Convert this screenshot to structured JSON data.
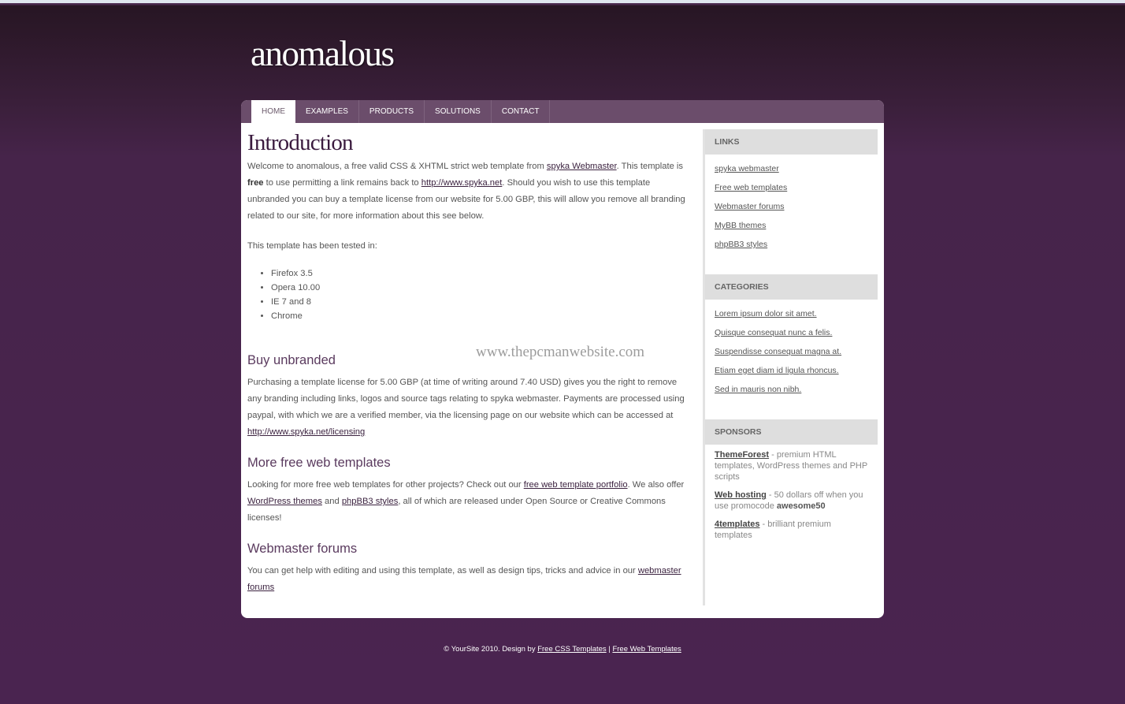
{
  "site": {
    "logo": "anomalous"
  },
  "nav": {
    "tabs": [
      {
        "label": "HOME",
        "active": true
      },
      {
        "label": "EXAMPLES",
        "active": false
      },
      {
        "label": "PRODUCTS",
        "active": false
      },
      {
        "label": "SOLUTIONS",
        "active": false
      },
      {
        "label": "CONTACT",
        "active": false
      }
    ]
  },
  "content": {
    "intro": {
      "title": "Introduction",
      "p1_a": "Welcome to anomalous, a free valid CSS & XHTML strict web template from ",
      "p1_link1": "spyka Webmaster",
      "p1_b": ". This template is ",
      "p1_bold": "free",
      "p1_c": " to use permitting a link remains back to ",
      "p1_link2": "http://www.spyka.net",
      "p1_d": ". Should you wish to use this template unbranded you can buy a template license from our website for 5.00 GBP, this will allow you remove all branding related to our site, for more information about this see below.",
      "p2": "This template has been tested in:",
      "browsers": [
        "Firefox 3.5",
        "Opera 10.00",
        "IE 7 and 8",
        "Chrome"
      ]
    },
    "buy": {
      "title": "Buy unbranded",
      "text": "Purchasing a template license for 5.00 GBP (at time of writing around 7.40 USD) gives you the right to remove any branding including links, logos and source tags relating to spyka webmaster. Payments are processed using paypal, with which we are a verified member, via the licensing page on our website which can be accessed at ",
      "link": "http://www.spyka.net/licensing"
    },
    "more": {
      "title": "More free web templates",
      "text_a": "Looking for more free web templates for other projects? Check out our ",
      "link1": "free web template portfolio",
      "text_b": ". We also offer ",
      "link2": "WordPress themes",
      "text_c": " and ",
      "link3": "phpBB3 styles",
      "text_d": ", all of which are released under Open Source or Creative Commons licenses!"
    },
    "forums": {
      "title": "Webmaster forums",
      "text": "You can get help with editing and using this template, as well as design tips, tricks and advice in our ",
      "link": "webmaster forums"
    },
    "watermark": "www.thepcmanwebsite.com"
  },
  "sidebar": {
    "links": {
      "title": "LINKS",
      "items": [
        "spyka webmaster",
        "Free web templates",
        "Webmaster forums",
        "MyBB themes",
        "phpBB3 styles"
      ]
    },
    "categories": {
      "title": "CATEGORIES",
      "items": [
        "Lorem ipsum dolor sit amet.",
        "Quisque consequat nunc a felis.",
        "Suspendisse consequat magna at.",
        "Etiam eget diam id ligula rhoncus.",
        "Sed in mauris non nibh."
      ]
    },
    "sponsors": {
      "title": "SPONSORS",
      "items": [
        {
          "name": "ThemeForest",
          "desc": " - premium HTML templates, WordPress themes and PHP scripts"
        },
        {
          "name": "Web hosting",
          "desc": " - 50 dollars off when you use promocode ",
          "code": "awesome50"
        },
        {
          "name": "4templates",
          "desc": " - brilliant premium templates"
        }
      ]
    }
  },
  "footer": {
    "text": "© YourSite 2010. Design by ",
    "link1": "Free CSS Templates",
    "sep": " | ",
    "link2": "Free Web Templates"
  }
}
